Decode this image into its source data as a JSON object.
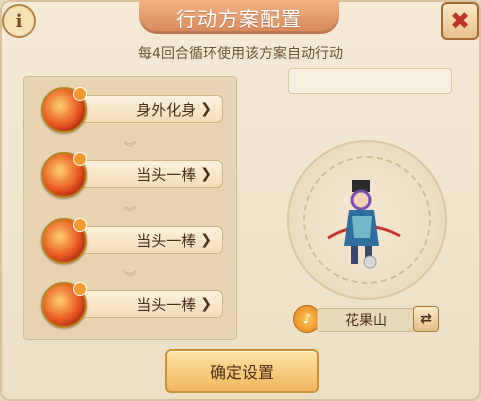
{
  "title": "行动方案配置",
  "subtitle": "每4回合循环使用该方案自动行动",
  "info_button": {
    "glyph": "i",
    "icon": "info-icon"
  },
  "close_button": {
    "glyph": "✖",
    "icon": "close-icon"
  },
  "actions": [
    {
      "label": "身外化身",
      "icon": "fire-skill-icon"
    },
    {
      "label": "当头一棒",
      "icon": "fire-skill-icon"
    },
    {
      "label": "当头一棒",
      "icon": "fire-skill-icon"
    },
    {
      "label": "当头一棒",
      "icon": "fire-skill-icon"
    }
  ],
  "chevron": "❯",
  "down_arrow": "︾",
  "character": {
    "school": "花果山",
    "school_icon_glyph": "♪",
    "swap_glyph": "⇄"
  },
  "confirm_label": "确定设置",
  "colors": {
    "title_bg": "#e1956a",
    "panel_bg": "#f2e6cf",
    "confirm_bg": "#f3c46f",
    "close_x": "#c0332a"
  }
}
